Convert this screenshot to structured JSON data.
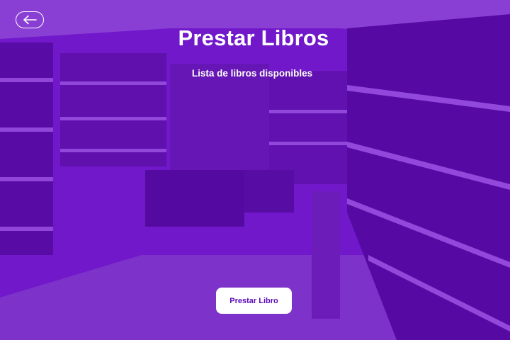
{
  "header": {
    "back_icon": "arrow-left-icon",
    "title": "Prestar Libros",
    "subtitle": "Lista de libros disponibles"
  },
  "book_list": {
    "items": []
  },
  "actions": {
    "lend_label": "Prestar Libro"
  },
  "colors": {
    "overlay": "#6c00dc",
    "button_background": "#ffffff",
    "button_text": "#5b0bb8",
    "text": "#ffffff"
  }
}
